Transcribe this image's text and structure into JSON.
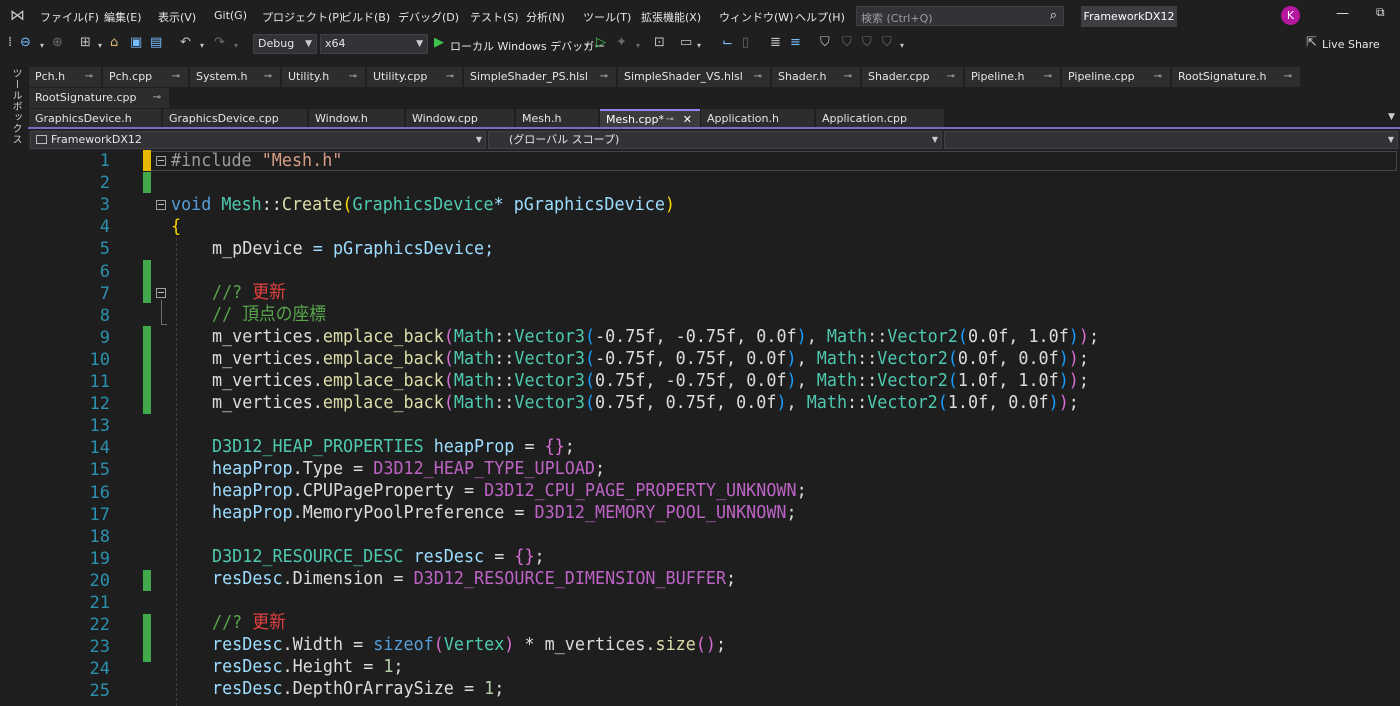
{
  "menu": [
    "ファイル(F)",
    "編集(E)",
    "表示(V)",
    "Git(G)",
    "プロジェクト(P)",
    "ビルド(B)",
    "デバッグ(D)",
    "テスト(S)",
    "分析(N)",
    "ツール(T)",
    "拡張機能(X)",
    "ウィンドウ(W)",
    "ヘルプ(H)"
  ],
  "search_placeholder": "検索 (Ctrl+Q)",
  "solution_name": "FrameworkDX12",
  "avatar_initial": "K",
  "toolbar": {
    "configuration": "Debug",
    "platform": "x64",
    "run_label": "ローカル Windows デバッガー",
    "live_share": "Live Share"
  },
  "toolbox_label": "ツールボックス",
  "tabs_row1": [
    "Pch.h",
    "Pch.cpp",
    "System.h",
    "Utility.h",
    "Utility.cpp",
    "SimpleShader_PS.hlsl",
    "SimpleShader_VS.hlsl",
    "Shader.h",
    "Shader.cpp",
    "Pipeline.h",
    "Pipeline.cpp",
    "RootSignature.h"
  ],
  "tabs_row2": [
    "RootSignature.cpp"
  ],
  "tabs_row3": [
    "GraphicsDevice.h",
    "GraphicsDevice.cpp",
    "Window.h",
    "Window.cpp",
    "Mesh.h",
    "Mesh.cpp*",
    "Application.h",
    "Application.cpp"
  ],
  "active_tab": "Mesh.cpp*",
  "navbar": {
    "project": "FrameworkDX12",
    "scope": "(グローバル スコープ)",
    "member": ""
  },
  "line_numbers": [
    "1",
    "2",
    "3",
    "4",
    "5",
    "6",
    "7",
    "8",
    "9",
    "10",
    "11",
    "12",
    "13",
    "14",
    "15",
    "16",
    "17",
    "18",
    "19",
    "20",
    "21",
    "22",
    "23",
    "24",
    "25"
  ],
  "code": {
    "l1_directive": "#include",
    "l1_file": "\"Mesh.h\"",
    "l3_void": "void",
    "l3_class": "Mesh",
    "l3_sep": "::",
    "l3_fn": "Create",
    "l3_param_type": "GraphicsDevice",
    "l3_param": "* pGraphicsDevice",
    "l4": "{",
    "l5_member": "m_pDevice",
    "l5_rest": " = pGraphicsDevice;",
    "l7_cmt": "//? ",
    "l7_todo": "更新",
    "l8_cmt": "// 頂点の座標",
    "vertex_lines": [
      {
        "v3": "-0.75f, -0.75f, 0.0f",
        "v2": "0.0f, 1.0f"
      },
      {
        "v3": "-0.75f, 0.75f, 0.0f",
        "v2": "0.0f, 0.0f"
      },
      {
        "v3": "0.75f, -0.75f, 0.0f",
        "v2": "1.0f, 1.0f"
      },
      {
        "v3": "0.75f, 0.75f, 0.0f",
        "v2": "1.0f, 0.0f"
      }
    ],
    "heap_type": "D3D12_HEAP_PROPERTIES",
    "heap_var": "heapProp",
    "heap_l15_field": "Type",
    "heap_l15_val": "D3D12_HEAP_TYPE_UPLOAD",
    "heap_l16_field": "CPUPageProperty",
    "heap_l16_val": "D3D12_CPU_PAGE_PROPERTY_UNKNOWN",
    "heap_l17_field": "MemoryPoolPreference",
    "heap_l17_val": "D3D12_MEMORY_POOL_UNKNOWN",
    "res_type": "D3D12_RESOURCE_DESC",
    "res_var": "resDesc",
    "res_l20_field": "Dimension",
    "res_l20_val": "D3D12_RESOURCE_DIMENSION_BUFFER",
    "l22_cmt": "//? ",
    "l22_todo": "更新",
    "res_l23_field": "Width",
    "res_l23_sizeof": "sizeof",
    "res_l23_type": "Vertex",
    "res_l23_rest": " * m_vertices.",
    "res_l23_fn": "size",
    "res_l24_field": "Height",
    "res_l24_val": "1",
    "res_l25_field": "DepthOrArraySize",
    "res_l25_val": "1"
  }
}
